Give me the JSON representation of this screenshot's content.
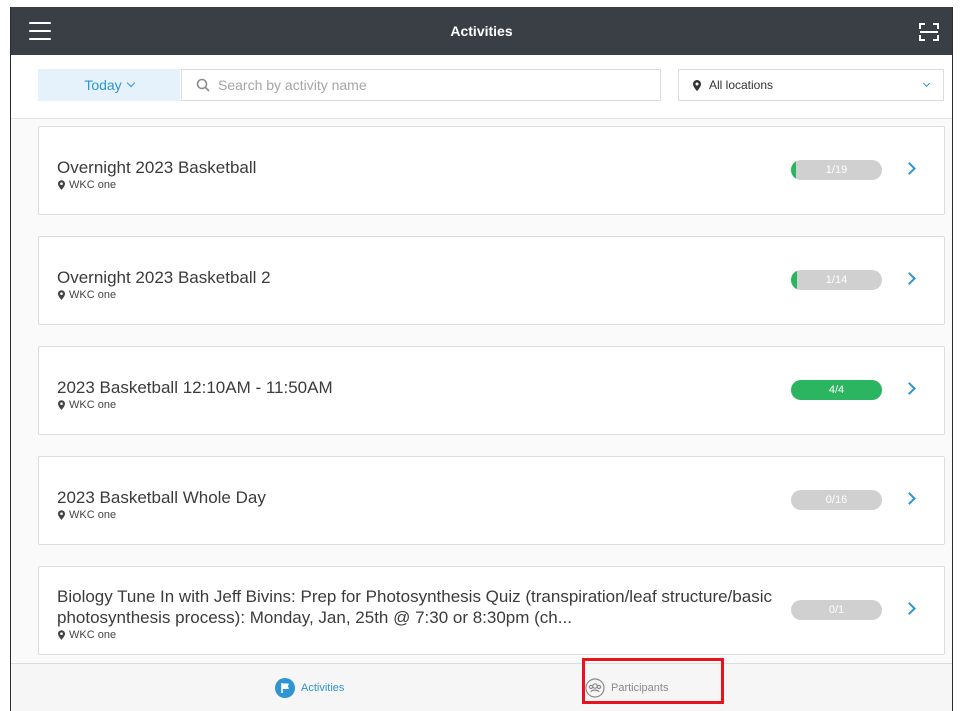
{
  "header": {
    "title": "Activities"
  },
  "filters": {
    "date_label": "Today",
    "search_placeholder": "Search by activity name",
    "search_value": "",
    "location_label": "All locations"
  },
  "activities": [
    {
      "name": "Overnight 2023 Basketball",
      "location": "WKC one",
      "count": "1/19",
      "fill": 0.05
    },
    {
      "name": "Overnight 2023 Basketball 2",
      "location": "WKC one",
      "count": "1/14",
      "fill": 0.07
    },
    {
      "name": "2023 Basketball 12:10AM - 11:50AM",
      "location": "WKC one",
      "count": "4/4",
      "fill": 1.0
    },
    {
      "name": "2023 Basketball Whole Day",
      "location": "WKC one",
      "count": "0/16",
      "fill": 0.0
    },
    {
      "name": "Biology Tune In with Jeff Bivins: Prep for Photosynthesis Quiz (transpiration/leaf structure/basic photosynthesis process): Monday, Jan, 25th @ 7:30 or 8:30pm (ch...",
      "location": "WKC one",
      "count": "0/1",
      "fill": 0.0
    }
  ],
  "bottom_nav": {
    "activities_label": "Activities",
    "participants_label": "Participants"
  },
  "colors": {
    "accent": "#2f95d2",
    "header_bg": "#3a3e45",
    "progress_fill": "#2bb560",
    "progress_track": "#d0d0d0",
    "highlight": "#e8131c"
  },
  "icons": {
    "menu": "hamburger-icon",
    "scan": "scan-icon",
    "search": "search-icon",
    "location": "location-pin-icon",
    "activities_tab": "flag-icon",
    "participants_tab": "group-icon"
  }
}
